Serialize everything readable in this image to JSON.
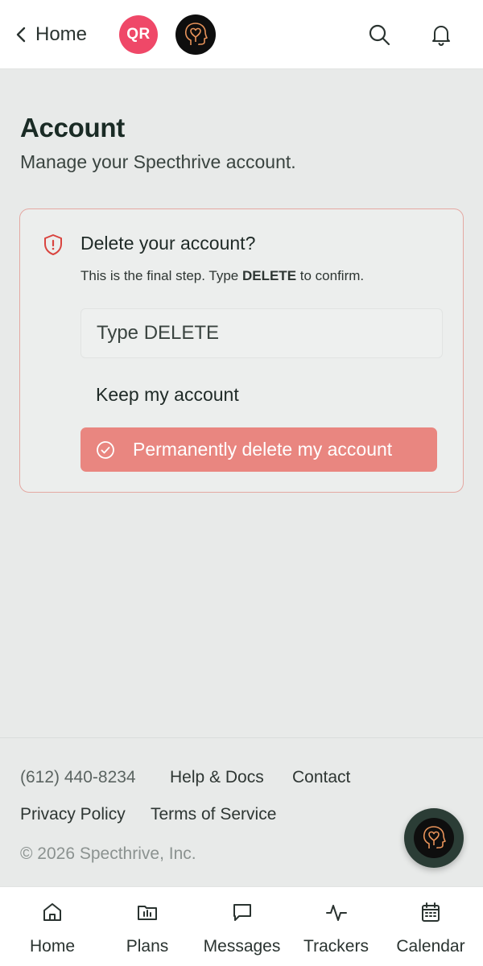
{
  "header": {
    "back_label": "Home",
    "qr_badge": "QR",
    "qr_color": "#ef4868"
  },
  "page": {
    "title": "Account",
    "subtitle": "Manage your Specthrive account."
  },
  "delete_card": {
    "title": "Delete your account?",
    "desc_prefix": "This is the final step. Type ",
    "desc_keyword": "DELETE",
    "desc_suffix": " to confirm.",
    "input_placeholder": "Type DELETE",
    "keep_label": "Keep my account",
    "delete_label": "Permanently delete my account",
    "danger_color": "#e98680"
  },
  "footer": {
    "phone": "(612) 440-8234",
    "help": "Help & Docs",
    "contact": "Contact",
    "privacy": "Privacy Policy",
    "terms": "Terms of Service",
    "copyright": "© 2026 Specthrive, Inc."
  },
  "bottom_nav": {
    "home": "Home",
    "plans": "Plans",
    "messages": "Messages",
    "trackers": "Trackers",
    "calendar": "Calendar"
  }
}
